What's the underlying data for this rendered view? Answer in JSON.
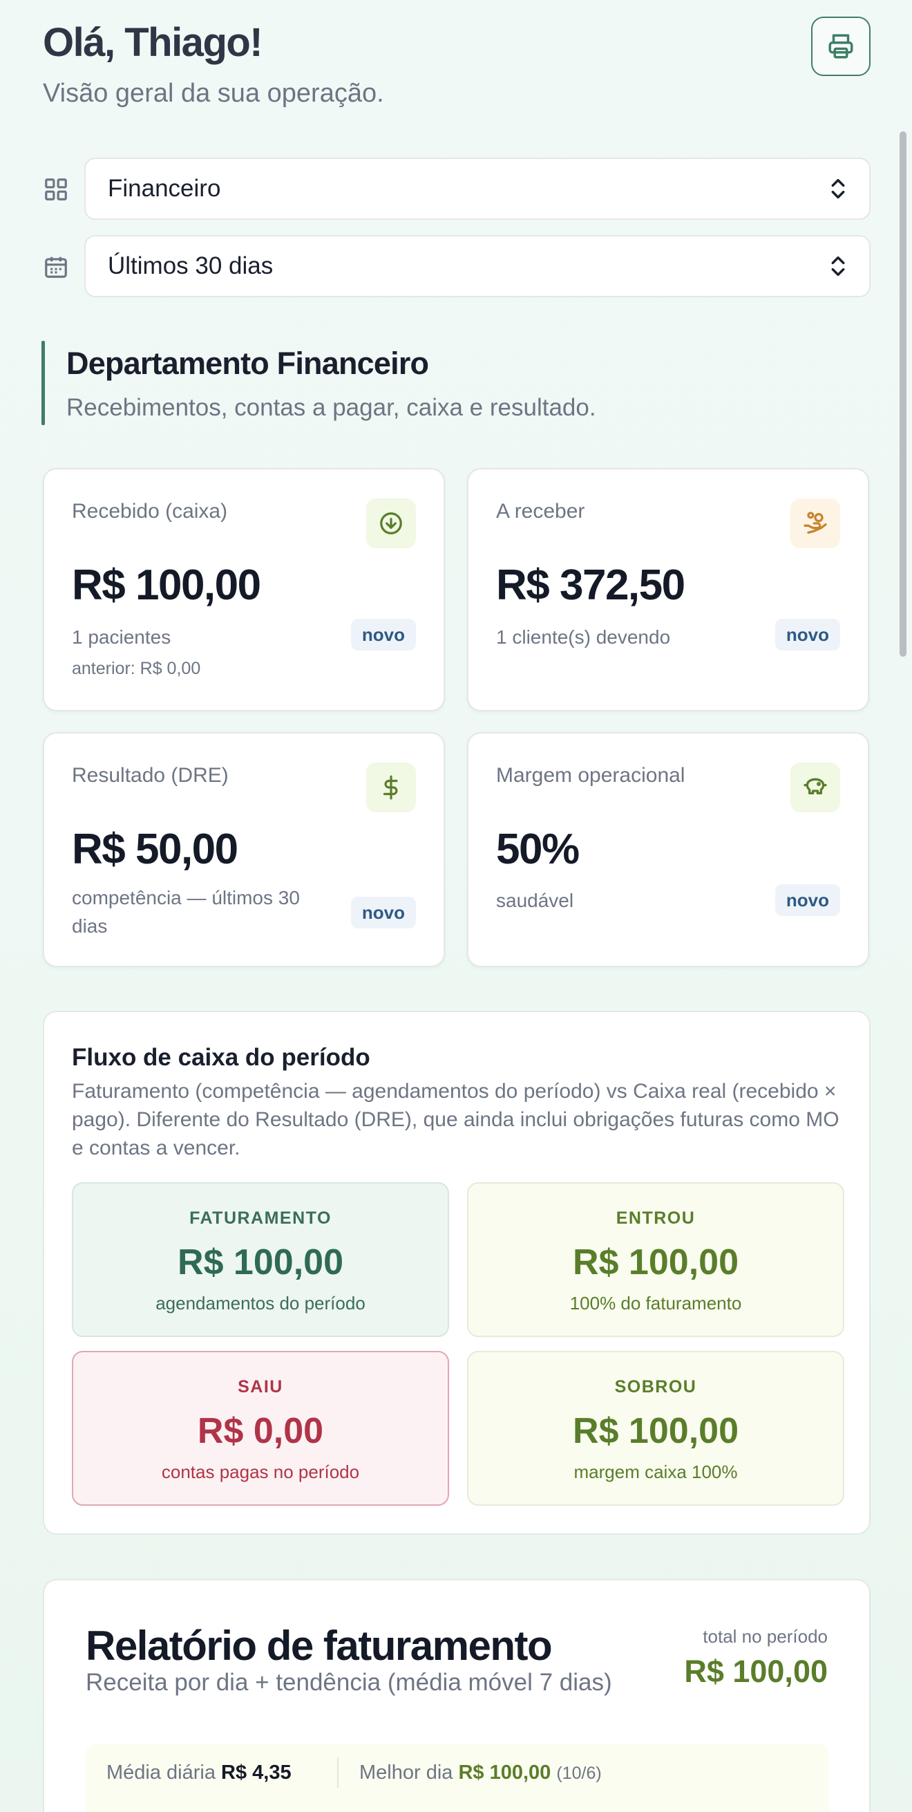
{
  "header": {
    "greeting": "Olá, Thiago!",
    "subtitle": "Visão geral da sua operação."
  },
  "filters": {
    "department": "Financeiro",
    "period": "Últimos 30 dias"
  },
  "section": {
    "title": "Departamento Financeiro",
    "subtitle": "Recebimentos, contas a pagar, caixa e resultado."
  },
  "kpis": [
    {
      "label": "Recebido (caixa)",
      "value": "R$ 100,00",
      "sub": "1 pacientes",
      "sub2": "anterior: R$ 0,00",
      "badge": "novo",
      "icon": "arrow-down-circle-icon"
    },
    {
      "label": "A receber",
      "value": "R$ 372,50",
      "sub": "1 cliente(s) devendo",
      "badge": "novo",
      "icon": "hand-coins-icon"
    },
    {
      "label": "Resultado (DRE)",
      "value": "R$ 50,00",
      "sub": "competência — últimos 30 dias",
      "badge": "novo",
      "icon": "dollar-sign-icon"
    },
    {
      "label": "Margem operacional",
      "value": "50%",
      "sub": "saudável",
      "badge": "novo",
      "icon": "piggy-bank-icon"
    }
  ],
  "cashflow": {
    "title": "Fluxo de caixa do período",
    "description": "Faturamento (competência — agendamentos do período) vs Caixa real (recebido × pago). Diferente do Resultado (DRE), que ainda inclui obrigações futuras como MO e contas a vencer.",
    "tiles": [
      {
        "label": "FATURAMENTO",
        "value": "R$ 100,00",
        "sub": "agendamentos do período"
      },
      {
        "label": "ENTROU",
        "value": "R$ 100,00",
        "sub": "100% do faturamento"
      },
      {
        "label": "SAIU",
        "value": "R$ 0,00",
        "sub": "contas pagas no período"
      },
      {
        "label": "SOBROU",
        "value": "R$ 100,00",
        "sub": "margem caixa 100%"
      }
    ]
  },
  "report": {
    "title": "Relatório de faturamento",
    "subtitle": "Receita por dia + tendência (média móvel 7 dias)",
    "total_label": "total no período",
    "total_value": "R$ 100,00",
    "avg_label": "Média diária",
    "avg_value": "R$ 4,35",
    "best_label": "Melhor dia",
    "best_value": "R$ 100,00",
    "best_date": "(10/6)"
  },
  "colors": {
    "brand_green": "#3f7e66",
    "positive_olive": "#5a7d2a",
    "negative_red": "#b03448",
    "badge_blue": "#2e5a84"
  }
}
